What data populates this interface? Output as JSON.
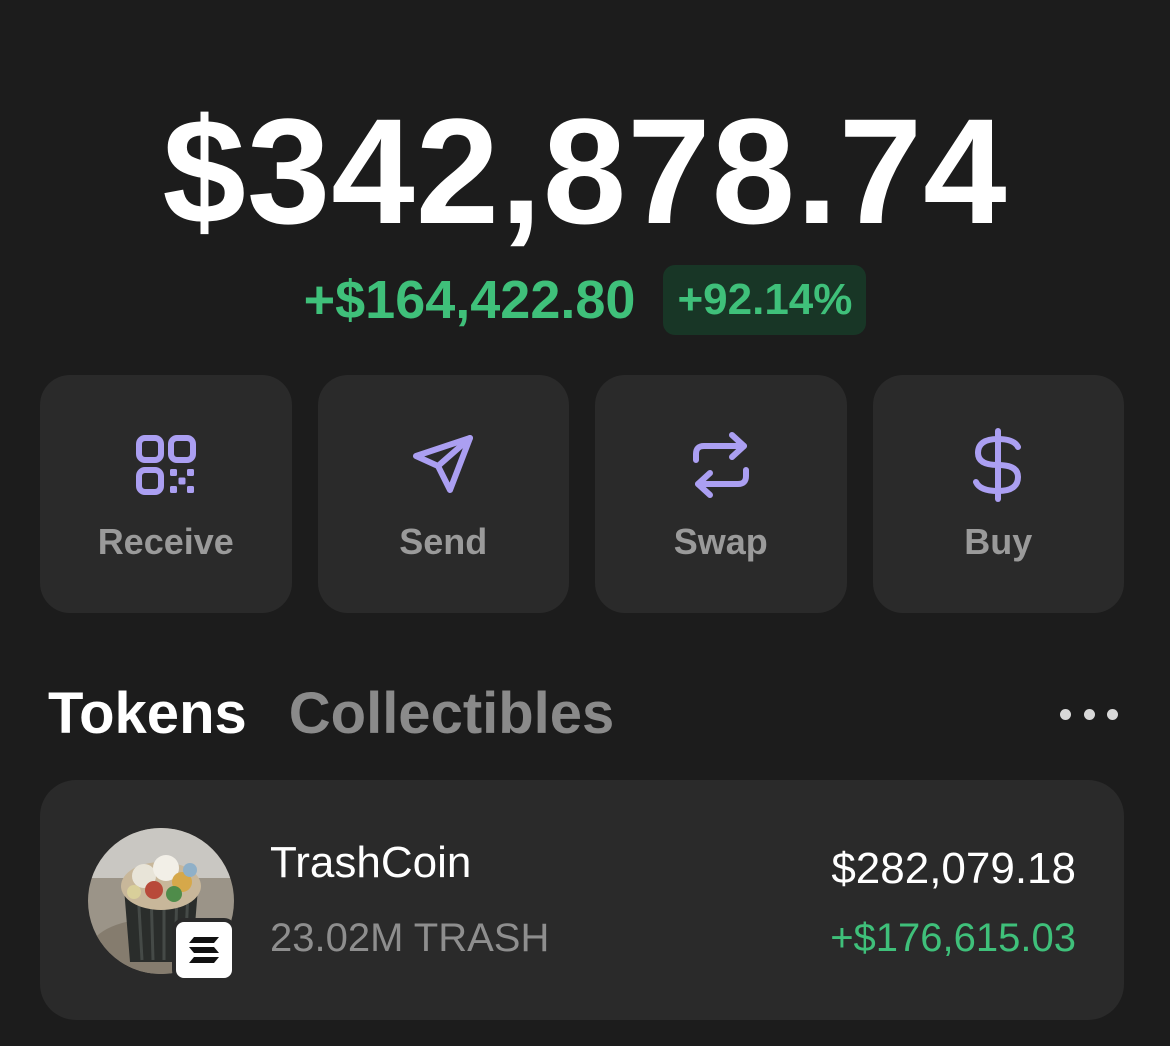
{
  "portfolio": {
    "balance": "$342,878.74",
    "change_amount": "+$164,422.80",
    "change_percent": "+92.14%"
  },
  "actions": [
    {
      "label": "Receive",
      "icon": "qr-code-icon"
    },
    {
      "label": "Send",
      "icon": "send-icon"
    },
    {
      "label": "Swap",
      "icon": "swap-icon"
    },
    {
      "label": "Buy",
      "icon": "dollar-icon"
    }
  ],
  "tabs": {
    "active": "Tokens",
    "inactive": "Collectibles"
  },
  "tokens": [
    {
      "name": "TrashCoin",
      "amount": "23.02M TRASH",
      "value": "$282,079.18",
      "change": "+$176,615.03",
      "chain_icon": "solana-icon"
    }
  ],
  "colors": {
    "background": "#1c1c1c",
    "card": "#2a2a2a",
    "positive": "#3fc07a",
    "accent": "#ab9ff2",
    "muted_text": "#9a9a9a"
  }
}
